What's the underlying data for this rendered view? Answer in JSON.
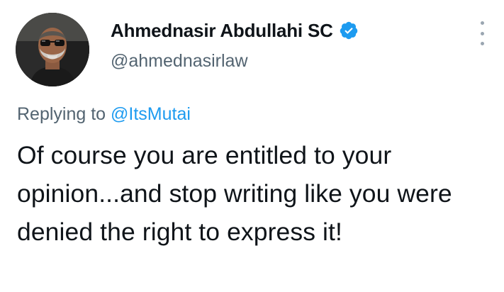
{
  "tweet": {
    "author": {
      "display_name": "Ahmednasir Abdullahi SC",
      "handle": "@ahmednasirlaw",
      "verified_icon": "verified-badge-icon",
      "avatar_icon": "profile-avatar"
    },
    "replying_to": {
      "prefix": "Replying to",
      "handle": "@ItsMutai"
    },
    "text": "Of course you are entitled to your opinion...and stop writing like you were denied the right to express it!",
    "more_icon": "more-options-icon"
  },
  "colors": {
    "text_primary": "#0f1419",
    "text_secondary": "#536471",
    "link": "#1d9bf0",
    "verified": "#1d9bf0",
    "background": "#ffffff"
  }
}
